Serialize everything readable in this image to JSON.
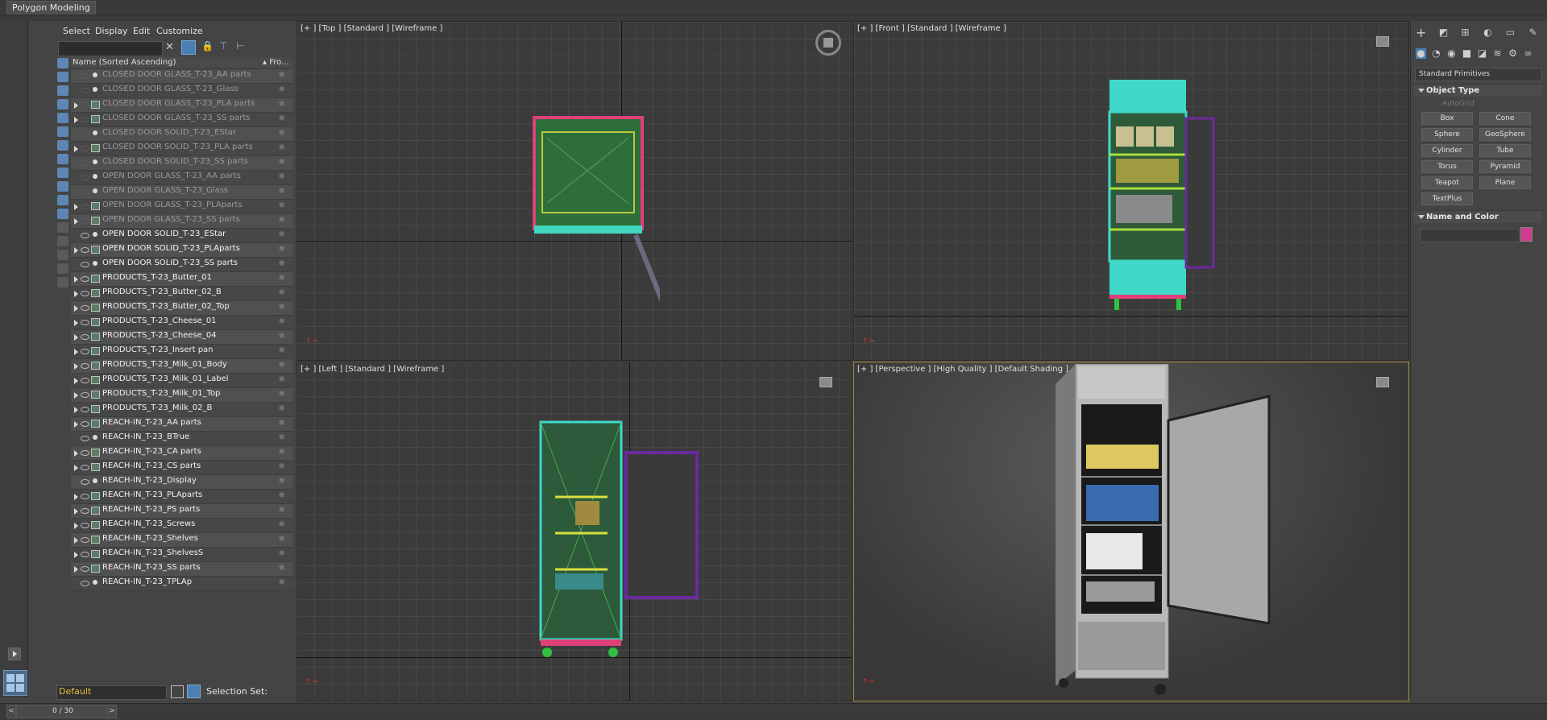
{
  "ribbon": {
    "active_tab": "Polygon Modeling"
  },
  "explorer": {
    "menus": [
      "Select",
      "Display",
      "Edit",
      "Customize"
    ],
    "column_name": "Name (Sorted Ascending)",
    "column_frozen": "▴ Fro...",
    "rows": [
      {
        "name": "CLOSED DOOR GLASS_T-23_AA parts",
        "frozen": true,
        "group": false,
        "expand": false,
        "visible": false
      },
      {
        "name": "CLOSED DOOR GLASS_T-23_Glass",
        "frozen": true,
        "group": false,
        "expand": false,
        "visible": false
      },
      {
        "name": "CLOSED DOOR GLASS_T-23_PLA parts",
        "frozen": true,
        "group": true,
        "expand": true,
        "visible": false
      },
      {
        "name": "CLOSED DOOR GLASS_T-23_SS parts",
        "frozen": true,
        "group": true,
        "expand": true,
        "visible": false
      },
      {
        "name": "CLOSED DOOR SOLID_T-23_EStar",
        "frozen": true,
        "group": false,
        "expand": false,
        "visible": false
      },
      {
        "name": "CLOSED DOOR SOLID_T-23_PLA parts",
        "frozen": true,
        "group": true,
        "expand": true,
        "visible": false
      },
      {
        "name": "CLOSED DOOR SOLID_T-23_SS parts",
        "frozen": true,
        "group": false,
        "expand": false,
        "visible": false
      },
      {
        "name": "OPEN DOOR GLASS_T-23_AA parts",
        "frozen": true,
        "group": false,
        "expand": false,
        "visible": false
      },
      {
        "name": "OPEN DOOR GLASS_T-23_Glass",
        "frozen": true,
        "group": false,
        "expand": false,
        "visible": false
      },
      {
        "name": "OPEN DOOR GLASS_T-23_PLAparts",
        "frozen": true,
        "group": true,
        "expand": true,
        "visible": false
      },
      {
        "name": "OPEN DOOR GLASS_T-23_SS parts",
        "frozen": true,
        "group": true,
        "expand": true,
        "visible": false
      },
      {
        "name": "OPEN DOOR SOLID_T-23_EStar",
        "frozen": false,
        "group": false,
        "expand": false,
        "visible": true
      },
      {
        "name": "OPEN DOOR SOLID_T-23_PLAparts",
        "frozen": false,
        "group": true,
        "expand": true,
        "visible": true
      },
      {
        "name": "OPEN DOOR SOLID_T-23_SS parts",
        "frozen": false,
        "group": false,
        "expand": false,
        "visible": true
      },
      {
        "name": "PRODUCTS_T-23_Butter_01",
        "frozen": false,
        "group": true,
        "expand": true,
        "visible": true
      },
      {
        "name": "PRODUCTS_T-23_Butter_02_B",
        "frozen": false,
        "group": true,
        "expand": true,
        "visible": true
      },
      {
        "name": "PRODUCTS_T-23_Butter_02_Top",
        "frozen": false,
        "group": true,
        "expand": true,
        "visible": true
      },
      {
        "name": "PRODUCTS_T-23_Cheese_01",
        "frozen": false,
        "group": true,
        "expand": true,
        "visible": true
      },
      {
        "name": "PRODUCTS_T-23_Cheese_04",
        "frozen": false,
        "group": true,
        "expand": true,
        "visible": true
      },
      {
        "name": "PRODUCTS_T-23_Insert pan",
        "frozen": false,
        "group": true,
        "expand": true,
        "visible": true
      },
      {
        "name": "PRODUCTS_T-23_Milk_01_Body",
        "frozen": false,
        "group": true,
        "expand": true,
        "visible": true
      },
      {
        "name": "PRODUCTS_T-23_Milk_01_Label",
        "frozen": false,
        "group": true,
        "expand": true,
        "visible": true
      },
      {
        "name": "PRODUCTS_T-23_Milk_01_Top",
        "frozen": false,
        "group": true,
        "expand": true,
        "visible": true
      },
      {
        "name": "PRODUCTS_T-23_Milk_02_B",
        "frozen": false,
        "group": true,
        "expand": true,
        "visible": true
      },
      {
        "name": "REACH-IN_T-23_AA parts",
        "frozen": false,
        "group": true,
        "expand": true,
        "visible": true
      },
      {
        "name": "REACH-IN_T-23_BTrue",
        "frozen": false,
        "group": false,
        "expand": false,
        "visible": true
      },
      {
        "name": "REACH-IN_T-23_CA parts",
        "frozen": false,
        "group": true,
        "expand": true,
        "visible": true
      },
      {
        "name": "REACH-IN_T-23_CS parts",
        "frozen": false,
        "group": true,
        "expand": true,
        "visible": true
      },
      {
        "name": "REACH-IN_T-23_Display",
        "frozen": false,
        "group": false,
        "expand": false,
        "visible": true
      },
      {
        "name": "REACH-IN_T-23_PLAparts",
        "frozen": false,
        "group": true,
        "expand": true,
        "visible": true
      },
      {
        "name": "REACH-IN_T-23_PS parts",
        "frozen": false,
        "group": true,
        "expand": true,
        "visible": true
      },
      {
        "name": "REACH-IN_T-23_Screws",
        "frozen": false,
        "group": true,
        "expand": true,
        "visible": true
      },
      {
        "name": "REACH-IN_T-23_Shelves",
        "frozen": false,
        "group": true,
        "expand": true,
        "visible": true
      },
      {
        "name": "REACH-IN_T-23_ShelvesS",
        "frozen": false,
        "group": true,
        "expand": true,
        "visible": true
      },
      {
        "name": "REACH-IN_T-23_SS parts",
        "frozen": false,
        "group": true,
        "expand": true,
        "visible": true
      },
      {
        "name": "REACH-IN_T-23_TPLAp",
        "frozen": false,
        "group": false,
        "expand": false,
        "visible": true
      }
    ],
    "layer": "Default",
    "selection_set_label": "Selection Set:"
  },
  "viewports": {
    "top": "[+ ]  [Top ]  [Standard ]  [Wireframe ]",
    "front": "[+ ]  [Front ]  [Standard ]  [Wireframe ]",
    "left": "[+ ]  [Left ]  [Standard ]  [Wireframe ]",
    "perspective": "[+ ]  [Perspective ]  [High Quality ]  [Default Shading ]"
  },
  "command_panel": {
    "dropdown": "Standard Primitives",
    "object_type_title": "Object Type",
    "autogrid_label": "AutoGrid",
    "primitives": [
      "Box",
      "Cone",
      "Sphere",
      "GeoSphere",
      "Cylinder",
      "Tube",
      "Torus",
      "Pyramid",
      "Teapot",
      "Plane",
      "TextPlus"
    ],
    "name_color_title": "Name and Color",
    "object_color": "#d33a8f"
  },
  "timeline": {
    "frame_display": "0 / 30",
    "prev": "<",
    "next": ">"
  }
}
